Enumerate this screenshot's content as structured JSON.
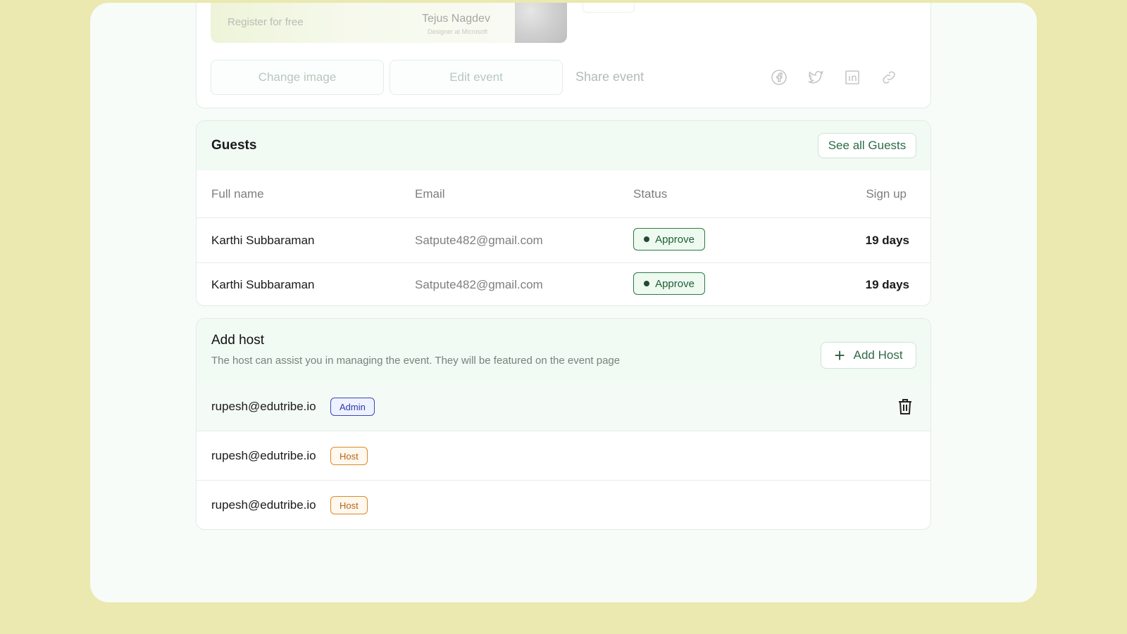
{
  "event": {
    "banner_register": "Register for free",
    "speaker_name": "Tejus Nagdev",
    "speaker_role": "Designer at Microsoft",
    "change_image": "Change image",
    "edit_event": "Edit event",
    "share_label": "Share event",
    "social_icons": [
      "facebook-icon",
      "twitter-icon",
      "linkedin-icon",
      "link-icon"
    ]
  },
  "guests": {
    "title": "Guests",
    "see_all": "See all Guests",
    "columns": [
      "Full name",
      "Email",
      "Status",
      "Sign up"
    ],
    "rows": [
      {
        "name": "Karthi Subbaraman",
        "email": "Satpute482@gmail.com",
        "status": "Approve",
        "signup": "19 days"
      },
      {
        "name": "Karthi Subbaraman",
        "email": "Satpute482@gmail.com",
        "status": "Approve",
        "signup": "19 days"
      }
    ]
  },
  "hosts": {
    "title": "Add host",
    "description": "The host can assist you in managing the event. They will be featured on the event page",
    "add_button": "Add Host",
    "rows": [
      {
        "email": "rupesh@edutribe.io",
        "role": "Admin"
      },
      {
        "email": "rupesh@edutribe.io",
        "role": "Host"
      },
      {
        "email": "rupesh@edutribe.io",
        "role": "Host"
      }
    ]
  },
  "colors": {
    "page_bg": "#ebe8b0",
    "accent_green": "#2d7a47",
    "admin_blue": "#3b49b8",
    "host_orange": "#d98a2b"
  }
}
